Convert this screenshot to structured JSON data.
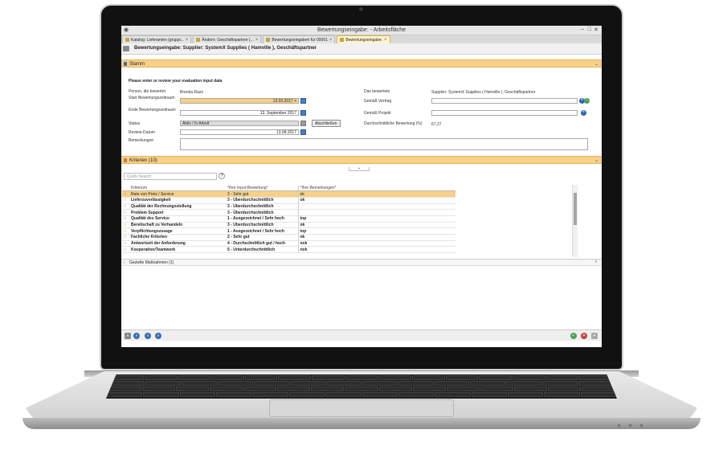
{
  "window": {
    "title": "Bewertungseingabe: - Arbeitsfläche"
  },
  "tabs": [
    {
      "label": "Katalog: Lieferanten (gruppi..."
    },
    {
      "label": "Ändern: Geschäftspartner (..."
    },
    {
      "label": "Bewertungseingaben für 00001"
    },
    {
      "label": "Bewertungseingabe:"
    }
  ],
  "header": {
    "title": "Bewertungseingabe: Supplier: SystemX Supplies ( Hamville ), Geschäftspartner"
  },
  "stamm": {
    "section_label": "Stamm",
    "hint": "Please enter or review your evaluation input data",
    "person_label": "Person, die bewertet",
    "person_value": "Brenda Razo",
    "start_label": "Start Bewertungszeitraum",
    "start_value": "13.03.2017",
    "end_label": "Ende Bewertungszeitraum",
    "end_value": "13. September 2017",
    "status_label": "Status",
    "status_value": "Aktiv / In Arbeit",
    "close_button": "Abschließen",
    "review_label": "Review-Datum",
    "review_value": "13.08.2017",
    "remarks_label": "Bemerkungen",
    "rated_label": "Das bewertete",
    "rated_value": "Supplier: SystemX Supplies ( Hamville ), Geschäftspartner",
    "contract_label": "Gemäß Vertrag",
    "project_label": "Gemäß Projekt",
    "avg_label": "Durchschnittliche Bewertung (%)",
    "avg_value": "67,27"
  },
  "criteria": {
    "section_label": "Kriterien (10)",
    "search_placeholder": "Quick-Search",
    "columns": [
      "Kriterium",
      "*Ihre Input-Bewertung*",
      "*Ihre Bemerkungen*"
    ],
    "rows": [
      {
        "k": "Rate von Preis / Service",
        "b": "2 - Sehr gut",
        "r": "ok"
      },
      {
        "k": "Lieferzuverlässigkeit",
        "b": "3 - Überdurchschnittlich",
        "r": "ok"
      },
      {
        "k": "Qualität der Rechnungsstellung",
        "b": "3 - Überdurchschnittlich",
        "r": ""
      },
      {
        "k": "Problem Support",
        "b": "3 - Überdurchschnittlich",
        "r": ""
      },
      {
        "k": "Qualität des Service",
        "b": "1 - Ausgezeichnet / Sehr hoch",
        "r": "top"
      },
      {
        "k": "Bereitschaft zu Verhandeln",
        "b": "3 - Überdurchschnittlich",
        "r": "ok"
      },
      {
        "k": "Verpflichtungszusage",
        "b": "1 - Ausgezeichnet / Sehr hoch",
        "r": "top"
      },
      {
        "k": "Fachliche Kriterien",
        "b": "2 - Sehr gut",
        "r": "ok"
      },
      {
        "k": "Antwortzeit der Anforderung",
        "b": "4 - Durchschnittlich gut / hoch",
        "r": "nok"
      },
      {
        "k": "Kooperation/Teamwork",
        "b": "5 - Unterdurchschnittlich",
        "r": "nok"
      }
    ]
  },
  "measures": {
    "label": "Gezielte Maßnahmen (1)"
  },
  "footer": {
    "nav": [
      "«",
      "«",
      "»",
      "»"
    ]
  }
}
